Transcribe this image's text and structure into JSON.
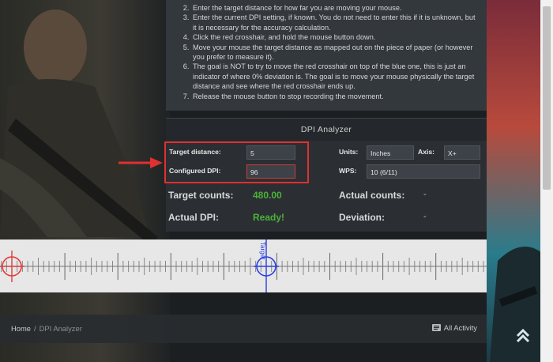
{
  "instructions": [
    "Enter the target distance for how far you are moving your mouse.",
    "Enter the current DPI setting, if known. You do not need to enter this if it is unknown, but it is necessary for the accuracy calculation.",
    "Click the red crosshair, and hold the mouse button down.",
    "Move your mouse the target distance as mapped out on the piece of paper (or however you prefer to measure it).",
    "The goal is NOT to try to move the red crosshair on top of the blue one, this is just an indicator of where 0% deviation is. The goal is to move your mouse physically the target distance and see where the red crosshair ends up.",
    "Release the mouse button to stop recording the movement."
  ],
  "analyzer": {
    "title": "DPI Analyzer",
    "target_distance_label": "Target distance:",
    "target_distance_value": "5",
    "configured_dpi_label": "Configured DPI:",
    "configured_dpi_value": "96",
    "units_label": "Units:",
    "units_value": "Inches",
    "axis_label": "Axis:",
    "axis_value": "X+",
    "wps_label": "WPS:",
    "wps_value": "10 (6/11)",
    "target_counts_label": "Target counts:",
    "target_counts_value": "480.00",
    "actual_counts_label": "Actual counts:",
    "actual_counts_value": "-",
    "actual_dpi_label": "Actual DPI:",
    "actual_dpi_value": "Ready!",
    "deviation_label": "Deviation:",
    "deviation_value": "-"
  },
  "ruler": {
    "target_label": "Target",
    "red_crosshair_fraction": 0.0,
    "blue_crosshair_fraction": 1.0
  },
  "footer": {
    "breadcrumb_home": "Home",
    "breadcrumb_current": "DPI Analyzer",
    "all_activity": "All Activity"
  },
  "colors": {
    "accent_green": "#4bb23a",
    "highlight_red": "#e03030",
    "crosshair_red": "#e23a3a",
    "crosshair_blue": "#2b3fe0"
  },
  "icons": {
    "all_activity": "activity-feed-icon",
    "back_to_top": "chevron-up-icon"
  }
}
